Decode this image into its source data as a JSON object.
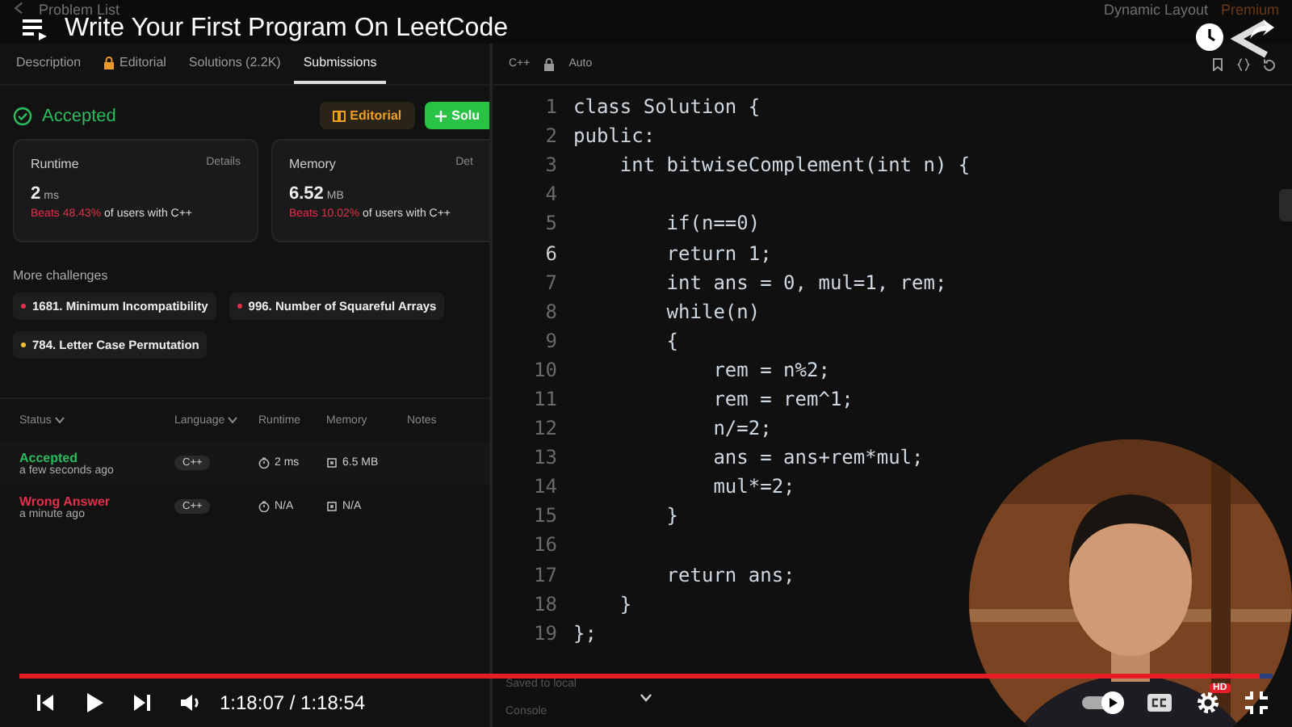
{
  "video": {
    "title": "Write Your First Program On LeetCode",
    "time": "1:18:07 / 1:18:54",
    "progress": {
      "level": 0.99
    },
    "hd_badge": "HD",
    "autoplay": {
      "on": true
    }
  },
  "top_bar": {
    "back_label": "Problem List",
    "layout_label": "Dynamic Layout",
    "premium_label": "Premium"
  },
  "tabs": [
    {
      "label": "Description",
      "locked": false,
      "selected": false
    },
    {
      "label": "Editorial",
      "locked": true,
      "selected": false
    },
    {
      "label": "Solutions (2.2K)",
      "locked": false,
      "selected": false
    },
    {
      "label": "Submissions",
      "locked": false,
      "selected": true
    }
  ],
  "result": {
    "status": "Accepted",
    "editorial_button": "Editorial",
    "solution_button": "Solu"
  },
  "stats": [
    {
      "title": "Runtime",
      "details": "Details",
      "value": "2",
      "unit": "ms",
      "beats": "Beats 48.43%",
      "suffix": "of users with C++"
    },
    {
      "title": "Memory",
      "details": "Det",
      "value": "6.52",
      "unit": "MB",
      "beats": "Beats 10.02%",
      "suffix": "of users with C++"
    }
  ],
  "challenges": {
    "title": "More challenges",
    "items": [
      {
        "label": "1681. Minimum Incompatibility",
        "color": "#e0304a"
      },
      {
        "label": "996. Number of Squareful Arrays",
        "color": "#e0304a"
      },
      {
        "label": "784. Letter Case Permutation",
        "color": "#f2c230"
      }
    ]
  },
  "submissions": {
    "columns": [
      "Status",
      "Language",
      "Runtime",
      "Memory",
      "Notes"
    ],
    "rows": [
      {
        "status": "Accepted",
        "accepted": true,
        "time": "a few seconds ago",
        "language": "C++",
        "runtime": "2 ms",
        "memory": "6.5 MB"
      },
      {
        "status": "Wrong Answer",
        "accepted": false,
        "time": "a minute ago",
        "language": "C++",
        "runtime": "N/A",
        "memory": "N/A"
      }
    ]
  },
  "editor": {
    "language": "C++",
    "mode": "Auto",
    "saved_note": "Saved to local",
    "console": "Console",
    "lines": [
      {
        "number": "1",
        "code": "class Solution {",
        "current": false
      },
      {
        "number": "2",
        "code": "public:",
        "current": false
      },
      {
        "number": "3",
        "code": "    int bitwiseComplement(int n) {",
        "current": false
      },
      {
        "number": "4",
        "current": false
      },
      {
        "number": "5",
        "code": "        if(n==0)",
        "current": false
      },
      {
        "number": "6",
        "code": "        return 1;",
        "current": true
      },
      {
        "number": "7",
        "code": "        int ans = 0, mul=1, rem;",
        "current": false
      },
      {
        "number": "8",
        "code": "        while(n)",
        "current": false
      },
      {
        "number": "9",
        "code": "        {",
        "current": false
      },
      {
        "number": "10",
        "code": "            rem = n%2;",
        "current": false
      },
      {
        "number": "11",
        "code": "            rem = rem^1;",
        "current": false
      },
      {
        "number": "12",
        "code": "            n/=2;",
        "current": false
      },
      {
        "number": "13",
        "code": "            ans = ans+rem*mul;",
        "current": false
      },
      {
        "number": "14",
        "code": "            mul*=2;",
        "current": false
      },
      {
        "number": "15",
        "code": "        }",
        "current": false
      },
      {
        "number": "16",
        "current": false
      },
      {
        "number": "17",
        "code": "        return ans;",
        "current": false
      },
      {
        "number": "18",
        "code": "    }",
        "current": false
      },
      {
        "number": "19",
        "code": "};",
        "current": false
      }
    ]
  }
}
